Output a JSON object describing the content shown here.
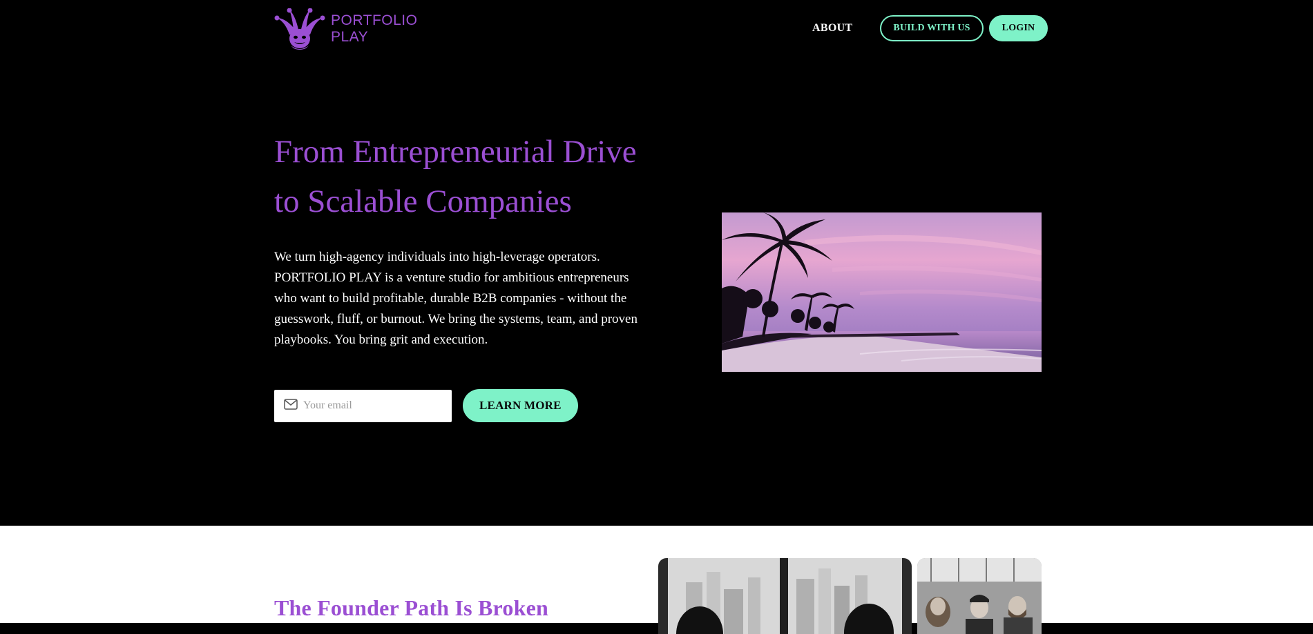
{
  "brand": {
    "name_line1": "PORTFOLIO",
    "name_line2": "PLAY",
    "logo_icon": "jester-hat-icon",
    "accent_color": "#9b4fd3"
  },
  "nav": {
    "about": "ABOUT",
    "build": "BUILD WITH US",
    "login": "LOGIN",
    "button_color": "#7ef2c8"
  },
  "hero": {
    "title": "From Entrepreneurial Drive to Scalable Companies",
    "description": "We turn high-agency individuals into high-leverage operators. PORTFOLIO PLAY is a venture studio for ambitious entrepreneurs who want to build profitable, durable B2B companies - without the guesswork, fluff, or burnout. We bring the systems, team, and proven playbooks. You bring grit and execution.",
    "email_placeholder": "Your email",
    "email_icon": "mail-icon",
    "cta": "LEARN MORE",
    "image": "beach-sunset-palm-trees"
  },
  "section2": {
    "title": "The Founder Path Is Broken",
    "photos": [
      "city-window-people-bw",
      "event-crowd-bw"
    ]
  }
}
